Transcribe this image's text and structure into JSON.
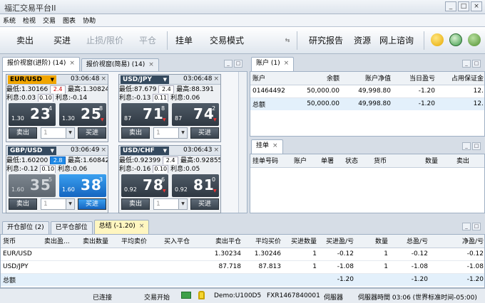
{
  "window": {
    "title": "福汇交易平台II",
    "minimize": "_",
    "maximize": "□",
    "close": "×"
  },
  "menu": [
    "系统",
    "检视",
    "交易",
    "图表",
    "协助"
  ],
  "toolbar": {
    "sell": "卖出",
    "buy": "买进",
    "stop_limit": "止损/限价",
    "close": "平仓",
    "order": "挂单",
    "trade_mode": "交易模式",
    "research": "研究报告",
    "resources": "资源",
    "online_chat": "网上谘询"
  },
  "quotes_panel": {
    "tabs": [
      {
        "label": "报价视窗(进阶) (14)",
        "close": "×"
      },
      {
        "label": "报价视窗(简易) (14)",
        "close": "×"
      }
    ],
    "cards": [
      {
        "symbol": "EUR/USD",
        "time": "03:06:48",
        "low_label": "最低:",
        "low": "1.30166",
        "spread": "2.4",
        "high_label": "最高:",
        "high": "1.30824",
        "int_label1": "利息:",
        "int1": "0.03",
        "int_mid": "0.10",
        "int_label2": "利息:",
        "int2": "-0.14",
        "sell_small": "1.30",
        "sell_big": "23",
        "sell_sup": "4",
        "buy_small": "1.30",
        "buy_big": "25",
        "buy_sup": "8",
        "qty": "1",
        "sell_label": "卖出",
        "buy_label": "买进"
      },
      {
        "symbol": "USD/JPY",
        "time": "03:06:48",
        "low_label": "最低:",
        "low": "87.679",
        "spread": "2.4",
        "high_label": "最高:",
        "high": "88.391",
        "int_label1": "利息:",
        "int1": "-0.13",
        "int_mid": "0.11",
        "int_label2": "利息:",
        "int2": "0.06",
        "sell_small": "87",
        "sell_big": "71",
        "sell_sup": "8",
        "buy_small": "87",
        "buy_big": "74",
        "buy_sup": "2",
        "qty": "1",
        "sell_label": "卖出",
        "buy_label": "买进"
      },
      {
        "symbol": "GBP/USD",
        "time": "03:06:49",
        "low_label": "最低:",
        "low": "1.60200",
        "spread": "2.8",
        "high_label": "最高:",
        "high": "1.60842",
        "int_label1": "利息:",
        "int1": "-0.12",
        "int_mid": "0.10",
        "int_label2": "利息:",
        "int2": "0.06",
        "sell_small": "1.60",
        "sell_big": "35",
        "sell_sup": "5",
        "buy_small": "1.60",
        "buy_big": "38",
        "buy_sup": "3",
        "qty": "1",
        "sell_label": "卖出",
        "buy_label": "买进"
      },
      {
        "symbol": "USD/CHF",
        "time": "03:06:43",
        "low_label": "最低:",
        "low": "0.92399",
        "spread": "2.4",
        "high_label": "最高:",
        "high": "0.92855",
        "int_label1": "利息:",
        "int1": "-0.16",
        "int_mid": "0.10",
        "int_label2": "利息:",
        "int2": "0.05",
        "sell_small": "0.92",
        "sell_big": "78",
        "sell_sup": "6",
        "buy_small": "0.92",
        "buy_big": "81",
        "buy_sup": "0",
        "qty": "1",
        "sell_label": "卖出",
        "buy_label": "买进"
      }
    ]
  },
  "accounts_panel": {
    "tab": "账户 (1)",
    "close": "×",
    "headers": [
      "账户",
      "余额",
      "账户净值",
      "当日盈亏",
      "占用保证金"
    ],
    "rows": [
      [
        "01464492",
        "50,000.00",
        "49,998.80",
        "-1.20",
        "12."
      ]
    ],
    "total": [
      "总额",
      "50,000.00",
      "49,998.80",
      "-1.20",
      "12."
    ]
  },
  "orders_panel": {
    "tab": "挂单",
    "close": "×",
    "headers": [
      "挂单号码",
      "账户",
      "单署",
      "状态",
      "货币",
      "数量",
      "卖出"
    ]
  },
  "positions_panel": {
    "tabs": [
      "开仓部位 (2)",
      "已平仓部位",
      "总结 (-1.20)"
    ],
    "close": "×",
    "headers": [
      "货币",
      "卖出盈...",
      "卖出数量",
      "平均卖价",
      "买入平仓",
      "卖出平仓",
      "平均买价",
      "买进数量",
      "买进盈/亏",
      "数量",
      "总盈/亏",
      "净盈/亏"
    ],
    "rows": [
      [
        "EUR/USD",
        "",
        "",
        "",
        "",
        "1.30234",
        "1.30246",
        "1",
        "-0.12",
        "1",
        "-0.12",
        "-0.12"
      ],
      [
        "USD/JPY",
        "",
        "",
        "",
        "",
        "87.718",
        "87.813",
        "1",
        "-1.08",
        "1",
        "-1.08",
        "-1.08"
      ]
    ],
    "total": [
      "总额",
      "",
      "",
      "",
      "",
      "",
      "",
      "",
      "-1.20",
      "",
      "-1.20",
      "-1.20"
    ]
  },
  "status": {
    "connected": "已连接",
    "trading": "交易开始",
    "demo": "Demo:U100D5",
    "server_id": "FXR1467840001",
    "server": "伺服器",
    "server_time": "伺服器時間 03:06 (世界标准时间-05:00)"
  }
}
